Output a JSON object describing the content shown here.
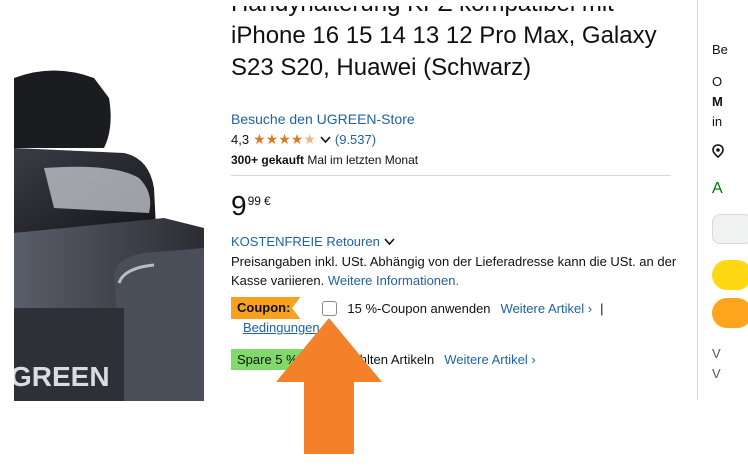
{
  "product": {
    "title_line0": "Handyhalterung KFZ kompatibel mit",
    "title_line1": "iPhone 16 15 14 13 12 Pro Max, Galaxy",
    "title_line2": "S23 S20, Huawei (Schwarz)",
    "store_link": "Besuche den UGREEN-Store",
    "rating": "4,3",
    "rating_stars": 4.3,
    "rating_count": "(9.537)",
    "bought_bold": "300+ gekauft",
    "bought_rest": " Mal im letzten Monat",
    "image_brand_text": "GREEN"
  },
  "price": {
    "whole": "9",
    "fraction": "99",
    "currency": "€"
  },
  "returns": {
    "label": "KOSTENFREIE Retouren"
  },
  "vat": {
    "text": "Preisangaben inkl. USt. Abhängig von der Lieferadresse kann die USt. an der Kasse variieren.",
    "link": "Weitere Informationen."
  },
  "coupon": {
    "badge": "Coupon:",
    "text": "15 %-Coupon anwenden",
    "more": "Weitere Artikel",
    "separator": "|",
    "conditions": "Bedingungen"
  },
  "save": {
    "badge": "Spare 5 %",
    "text": "ausgewählten Artikeln",
    "more": "Weitere Artikel"
  },
  "right_column": {
    "be": "Be",
    "o": "O",
    "m": "M",
    "in": "in",
    "a": "A",
    "v1": "V",
    "v2": "V"
  },
  "colors": {
    "link": "#2162a1",
    "coupon_badge": "#f7a11f",
    "save_badge": "#7fda69",
    "arrow": "#f5802a",
    "star": "#de7921"
  }
}
